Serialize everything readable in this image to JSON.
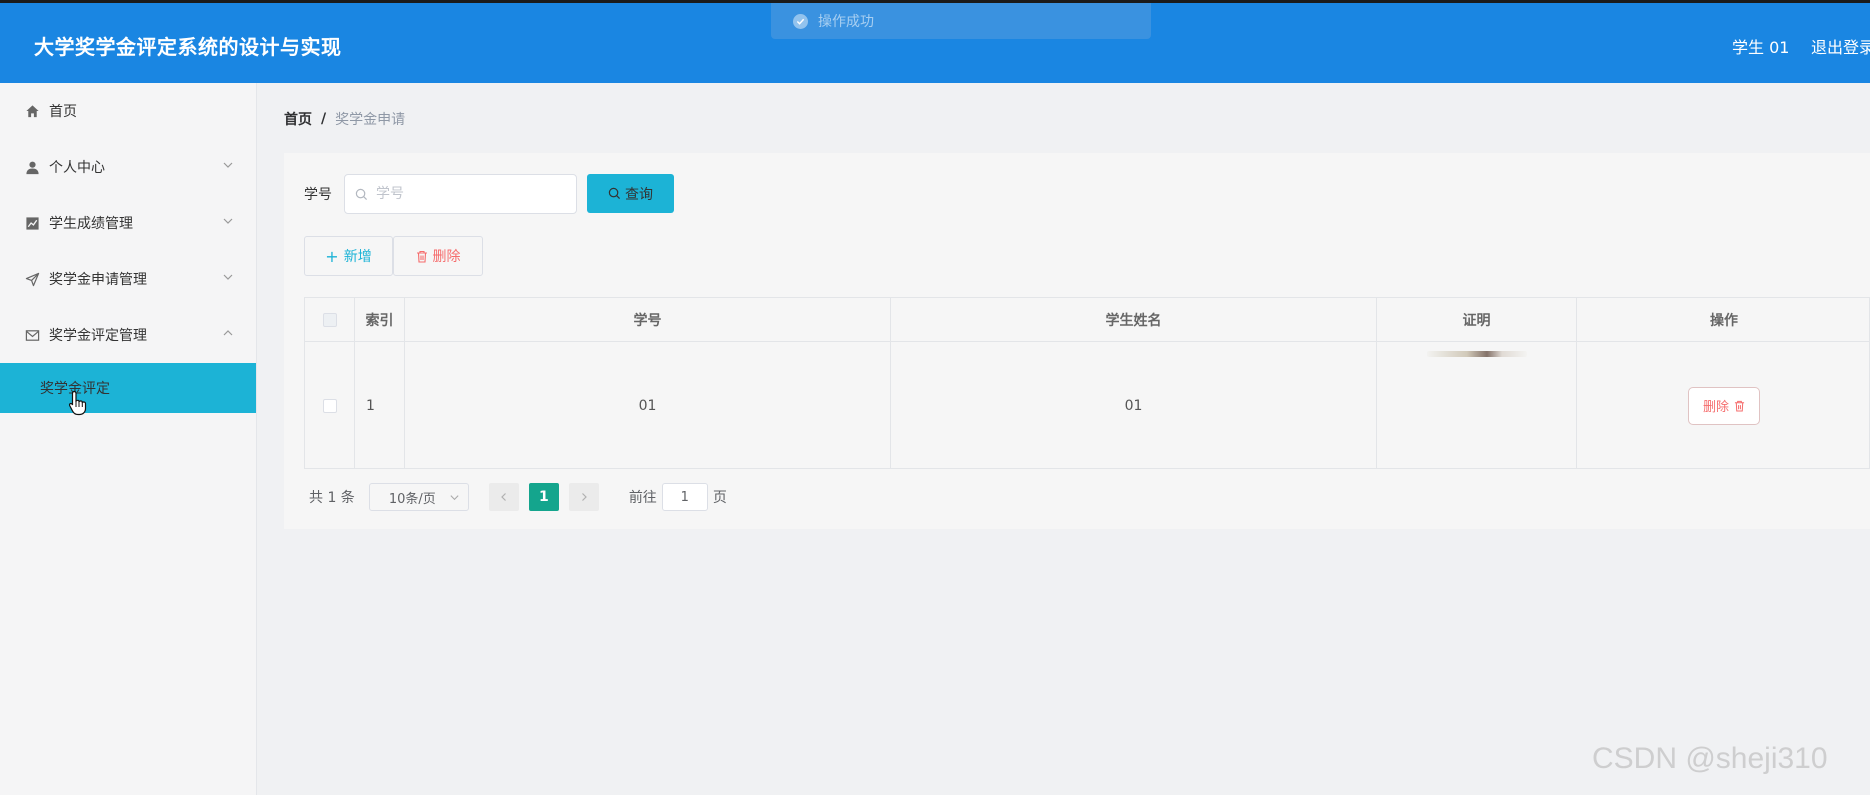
{
  "header": {
    "title": "大学奖学金评定系统的设计与实现",
    "user": "学生 01",
    "logout": "退出登录"
  },
  "toast": {
    "message": "操作成功"
  },
  "sidebar": {
    "items": [
      {
        "label": "首页",
        "icon": "home-icon"
      },
      {
        "label": "个人中心",
        "icon": "user-icon"
      },
      {
        "label": "学生成绩管理",
        "icon": "chart-icon"
      },
      {
        "label": "奖学金申请管理",
        "icon": "send-icon"
      },
      {
        "label": "奖学金评定管理",
        "icon": "mail-icon"
      }
    ],
    "submenu": [
      {
        "label": "奖学金评定"
      }
    ]
  },
  "breadcrumb": {
    "home": "首页",
    "separator": "/",
    "current": "奖学金申请"
  },
  "search": {
    "label": "学号",
    "placeholder": "学号",
    "value": "",
    "button": "查询"
  },
  "actions": {
    "add": "新增",
    "delete": "删除"
  },
  "table": {
    "columns": [
      "索引",
      "学号",
      "学生姓名",
      "证明",
      "操作"
    ],
    "rows": [
      {
        "index": "1",
        "student_id": "01",
        "student_name": "01",
        "action": "删除"
      }
    ]
  },
  "pagination": {
    "total": "共 1 条",
    "page_size": "10条/页",
    "current_page": "1",
    "goto_prefix": "前往",
    "goto_value": "1",
    "goto_suffix": "页"
  },
  "watermark": "CSDN @sheji310",
  "colors": {
    "header": "#1a86e2",
    "accent": "#1cb3d6",
    "danger": "#f56c6c",
    "pager_active": "#14a58d"
  }
}
